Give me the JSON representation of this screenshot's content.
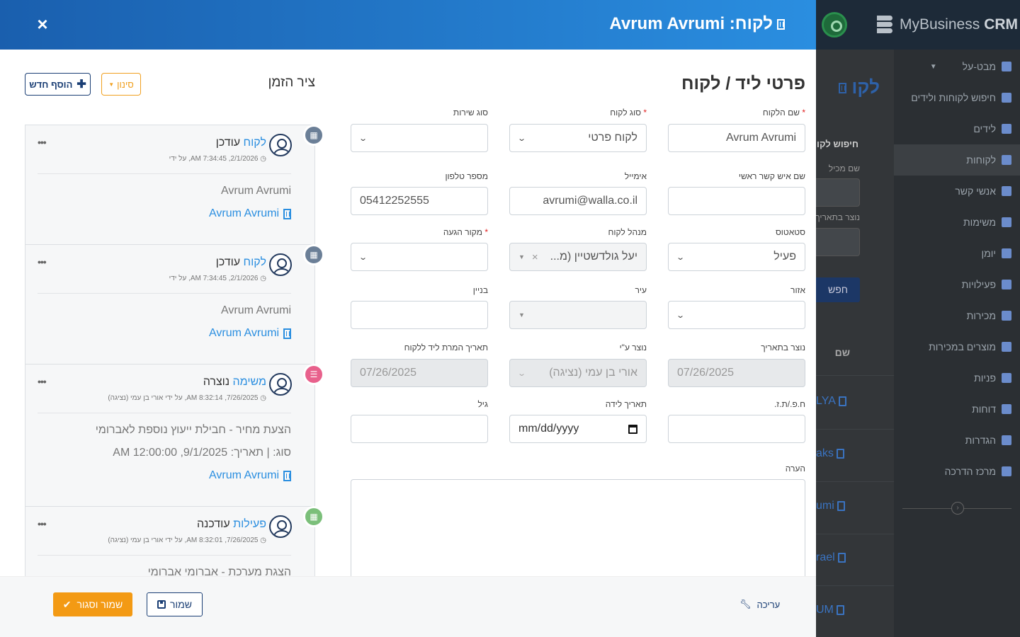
{
  "background": {
    "logo_text": "MyBusiness",
    "logo_bold": "CRM",
    "sidebar": [
      {
        "label": "מבט-על",
        "icon": "chart-icon"
      },
      {
        "label": "חיפוש לקוחות ולידים",
        "icon": "search-icon"
      },
      {
        "label": "לידים",
        "icon": "megaphone-icon"
      },
      {
        "label": "לקוחות",
        "icon": "building-icon"
      },
      {
        "label": "אנשי קשר",
        "icon": "user-icon"
      },
      {
        "label": "משימות",
        "icon": "list-icon"
      },
      {
        "label": "יומן",
        "icon": "calendar-icon"
      },
      {
        "label": "פעילויות",
        "icon": "calendar-icon"
      },
      {
        "label": "מכירות",
        "icon": "handshake-icon"
      },
      {
        "label": "מוצרים במכירות",
        "icon": "box-icon"
      },
      {
        "label": "פניות",
        "icon": "headset-icon"
      },
      {
        "label": "דוחות",
        "icon": "file-icon"
      },
      {
        "label": "הגדרות",
        "icon": "gear-icon"
      },
      {
        "label": "מרכז הדרכה",
        "icon": "question-icon"
      }
    ],
    "page_title": "לקו",
    "search_section": "חיפוש לקוחות",
    "label_1": "שם מכיל",
    "label_2": "נוצר בתאריך",
    "search_btn": "חפש",
    "col_name": "שם",
    "rows": [
      "LYA",
      "aks",
      "umi",
      "rael",
      "UM"
    ]
  },
  "modal": {
    "title": "לקוח: Avrum Avrumi",
    "close_label": "×",
    "form_title": "פרטי ליד / לקוח",
    "fields": {
      "customer_name": {
        "label": "שם הלקוח",
        "value": "Avrum Avrumi"
      },
      "customer_type": {
        "label": "סוג לקוח",
        "value": "לקוח פרטי"
      },
      "service_type": {
        "label": "סוג שירות",
        "value": ""
      },
      "contact_name": {
        "label": "שם איש קשר ראשי",
        "value": ""
      },
      "email": {
        "label": "אימייל",
        "value": "avrumi@walla.co.il"
      },
      "phone": {
        "label": "מספר טלפון",
        "value": "05412252555"
      },
      "status": {
        "label": "סטאטוס",
        "value": "פעיל"
      },
      "manager": {
        "label": "מנהל לקוח",
        "value": "יעל גולדשטיין (מ..."
      },
      "source": {
        "label": "מקור הגעה",
        "value": ""
      },
      "region": {
        "label": "אזור",
        "value": ""
      },
      "city": {
        "label": "עיר",
        "value": ""
      },
      "building": {
        "label": "בניין",
        "value": ""
      },
      "created_date": {
        "label": "נוצר בתאריך",
        "value": "07/26/2025"
      },
      "created_by": {
        "label": "נוצר ע\"י",
        "value": "אורי בן עמי (נציגה)"
      },
      "conversion_date": {
        "label": "תאריך המרת ליד ללקוח",
        "value": "07/26/2025"
      },
      "id_number": {
        "label": "ח.פ./ת.ז.",
        "value": ""
      },
      "birth_date": {
        "label": "תאריך לידה",
        "value": "mm/dd/yyyy"
      },
      "age": {
        "label": "גיל",
        "value": ""
      },
      "note": {
        "label": "הערה",
        "value": ""
      }
    },
    "required_mark": "*",
    "timeline": {
      "title": "ציר הזמן",
      "filter_label": "סינון",
      "add_label": "הוסף חדש",
      "events": [
        {
          "link": "לקוח",
          "verb": "עודכן",
          "meta": "2/1/2026, 7:34:45 AM, על ידי",
          "line1": "Avrum Avrumi",
          "link_line": "Avrum Avrumi",
          "color": "#6b7f97"
        },
        {
          "link": "לקוח",
          "verb": "עודכן",
          "meta": "2/1/2026, 7:34:45 AM, על ידי",
          "line1": "Avrum Avrumi",
          "link_line": "Avrum Avrumi",
          "color": "#6b7f97"
        },
        {
          "link": "משימה",
          "verb": "נוצרה",
          "meta": "7/26/2025, 8:32:14 AM, על ידי אורי בן עמי (נציגה)",
          "line1": "הצעת מחיר - חבילת ייעוץ נוספת לאברומי",
          "line2": "סוג: | תאריך: 9/1/2025, 12:00:00 AM",
          "link_line": "Avrum Avrumi",
          "color": "#e8618c"
        },
        {
          "link": "פעילות",
          "verb": "עודכנה",
          "meta": "7/26/2025, 8:32:01 AM, על ידי אורי בן עמי (נציגה)",
          "line1": "הצגת מערכת - אברומי אברומי",
          "color": "#7bbf7a"
        }
      ]
    },
    "footer": {
      "save_close": "שמור וסגור",
      "save": "שמור",
      "edit": "עריכה"
    }
  }
}
